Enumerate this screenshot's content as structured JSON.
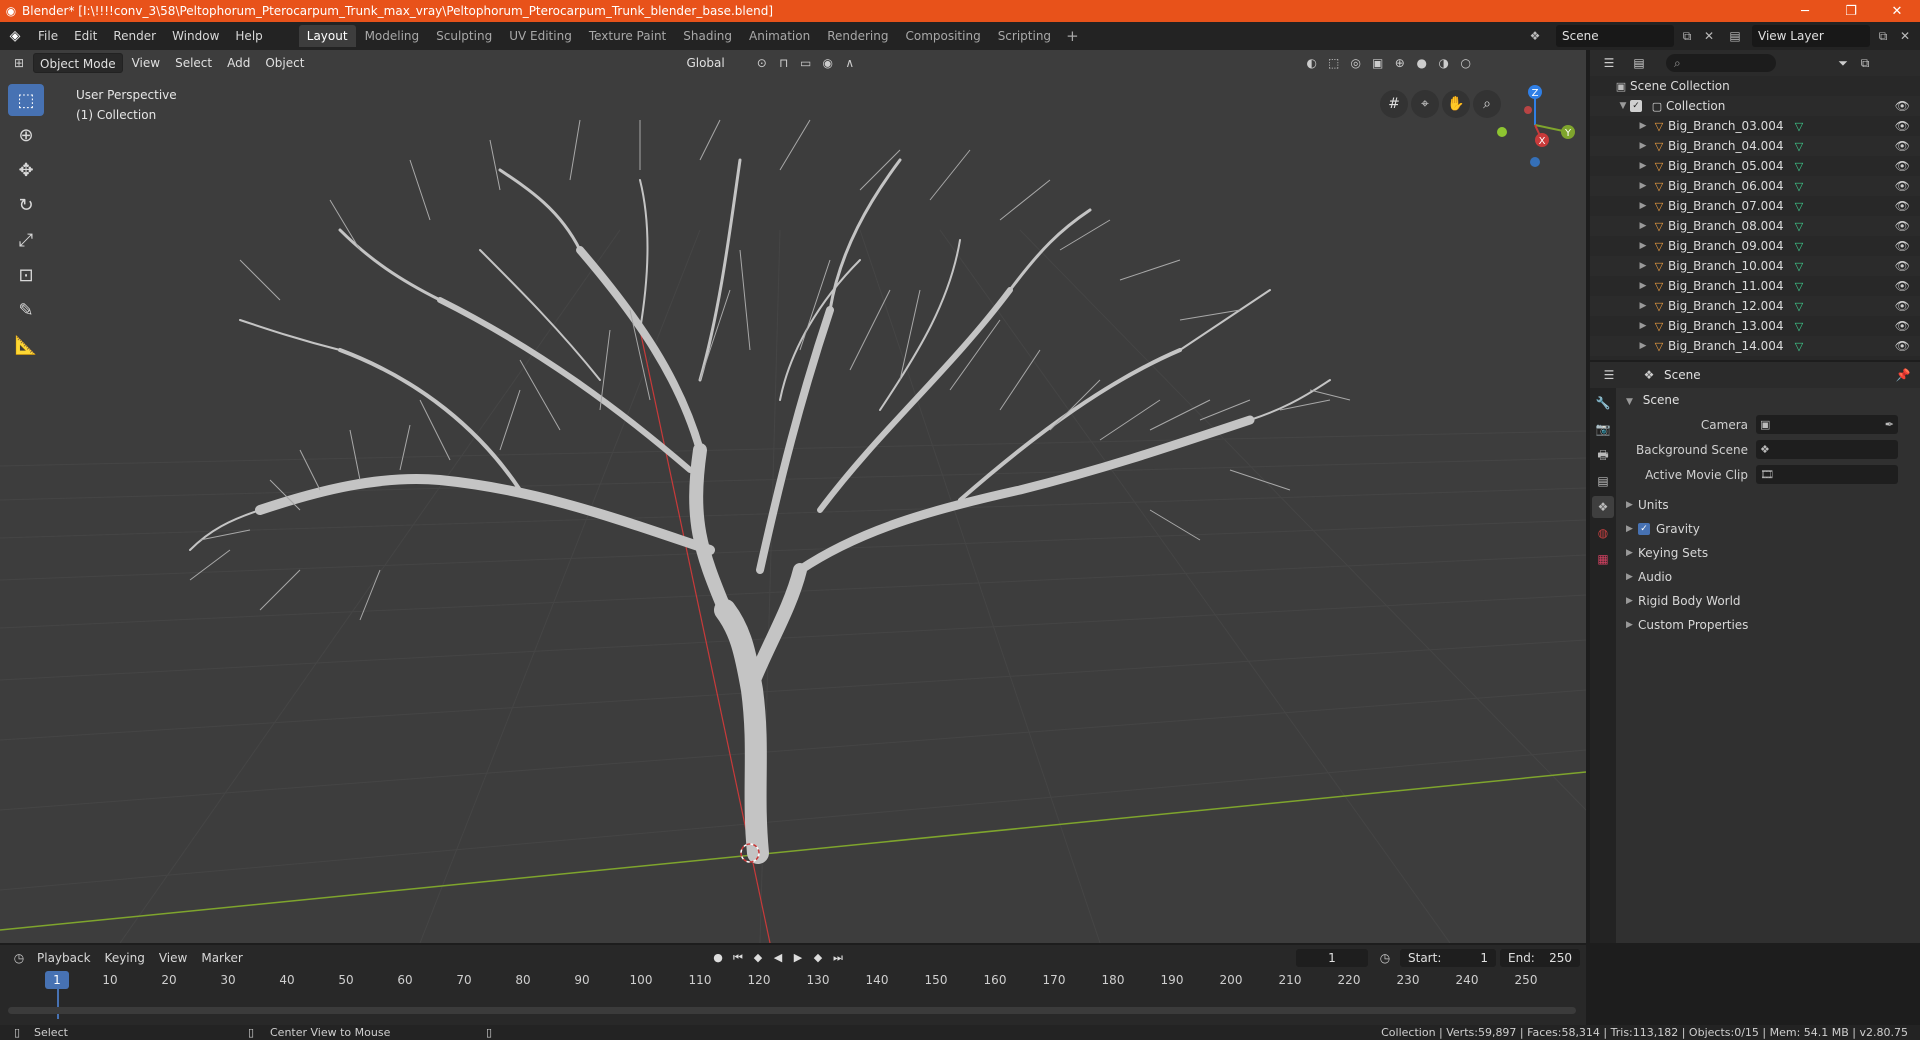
{
  "window": {
    "title": "Blender* [I:\\!!!!conv_3\\58\\Peltophorum_Pterocarpum_Trunk_max_vray\\Peltophorum_Pterocarpum_Trunk_blender_base.blend]"
  },
  "menu": {
    "items": [
      "File",
      "Edit",
      "Render",
      "Window",
      "Help"
    ]
  },
  "workspaces": {
    "tabs": [
      "Layout",
      "Modeling",
      "Sculpting",
      "UV Editing",
      "Texture Paint",
      "Shading",
      "Animation",
      "Rendering",
      "Compositing",
      "Scripting"
    ],
    "active": "Layout",
    "add": "+"
  },
  "scene_selector": {
    "value": "Scene"
  },
  "view_layer": {
    "value": "View Layer"
  },
  "viewport": {
    "mode": "Object Mode",
    "menus": [
      "View",
      "Select",
      "Add",
      "Object"
    ],
    "transform_orientation": "Global",
    "info_line1": "User Perspective",
    "info_line2": "(1) Collection",
    "gizmo_axes": {
      "z": "Z",
      "y": "Y",
      "x": "X"
    }
  },
  "outliner": {
    "root": "Scene Collection",
    "collection": "Collection",
    "items": [
      "Big_Branch_03.004",
      "Big_Branch_04.004",
      "Big_Branch_05.004",
      "Big_Branch_06.004",
      "Big_Branch_07.004",
      "Big_Branch_08.004",
      "Big_Branch_09.004",
      "Big_Branch_10.004",
      "Big_Branch_11.004",
      "Big_Branch_12.004",
      "Big_Branch_13.004",
      "Big_Branch_14.004"
    ]
  },
  "properties": {
    "context": "Scene",
    "panel": "Scene",
    "camera_label": "Camera",
    "background_scene_label": "Background Scene",
    "active_movie_clip_label": "Active Movie Clip",
    "subpanels": [
      "Units",
      "Gravity",
      "Keying Sets",
      "Audio",
      "Rigid Body World",
      "Custom Properties"
    ]
  },
  "timeline": {
    "menus": [
      "Playback",
      "Keying",
      "View",
      "Marker"
    ],
    "current_frame": "1",
    "start_label": "Start:",
    "start": "1",
    "end_label": "End:",
    "end": "250",
    "ticks": [
      "1",
      "10",
      "20",
      "30",
      "40",
      "50",
      "60",
      "70",
      "80",
      "90",
      "100",
      "110",
      "120",
      "130",
      "140",
      "150",
      "160",
      "170",
      "180",
      "190",
      "200",
      "210",
      "220",
      "230",
      "240",
      "250"
    ]
  },
  "statusbar": {
    "left": "Select",
    "middle": "Center View to Mouse",
    "right": "Collection | Verts:59,897 | Faces:58,314 | Tris:113,182 | Objects:0/15 | Mem: 54.1 MB | v2.80.75"
  },
  "colors": {
    "title_bar": "#e8521a",
    "accent": "#4772b3",
    "x_axis": "#c83a3a",
    "y_axis": "#7fa52d",
    "z_axis": "#2f7fe6"
  }
}
